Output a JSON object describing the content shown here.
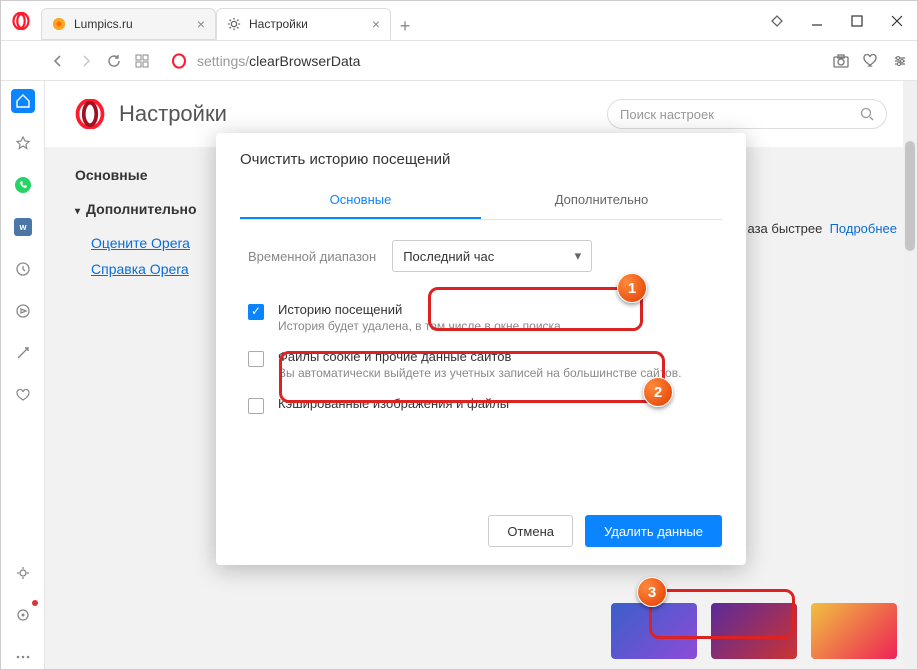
{
  "tabs": [
    {
      "title": "Lumpics.ru",
      "active": false
    },
    {
      "title": "Настройки",
      "active": true
    }
  ],
  "address": {
    "prefix": "settings/",
    "path": "clearBrowserData"
  },
  "settings": {
    "title": "Настройки",
    "search_placeholder": "Поиск настроек",
    "nav_basic": "Основные",
    "nav_advanced": "Дополнительно",
    "link_rate": "Оцените Opera",
    "link_help": "Справка Opera",
    "promo_text": "аза быстрее",
    "promo_more": "Подробнее"
  },
  "modal": {
    "title": "Очистить историю посещений",
    "tab_basic": "Основные",
    "tab_advanced": "Дополнительно",
    "range_label": "Временной диапазон",
    "range_value": "Последний час",
    "opts": [
      {
        "title": "Историю посещений",
        "desc": "История будет удалена, в том числе в окне поиска",
        "checked": true
      },
      {
        "title": "Файлы cookie и прочие данные сайтов",
        "desc": "Вы автоматически выйдете из учетных записей на большинстве сайтов.",
        "checked": false
      },
      {
        "title": "Кэшированные изображения и файлы",
        "desc": "",
        "checked": false
      }
    ],
    "cancel": "Отмена",
    "confirm": "Удалить данные"
  },
  "badges": {
    "b1": "1",
    "b2": "2",
    "b3": "3"
  }
}
